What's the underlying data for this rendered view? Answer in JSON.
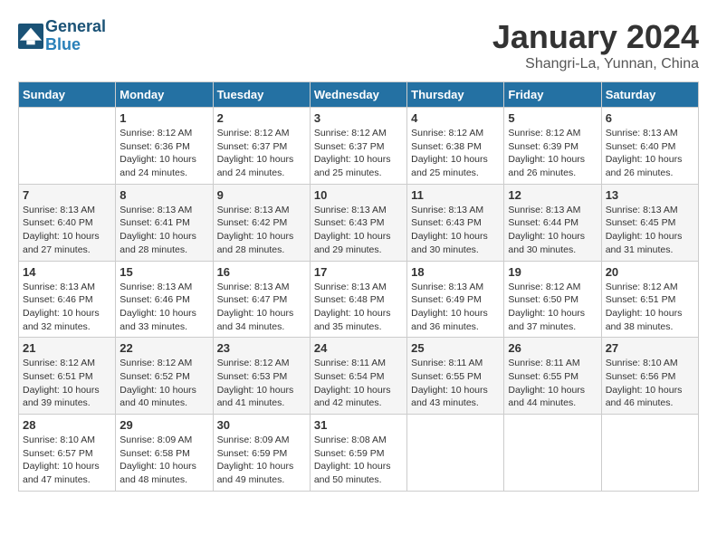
{
  "header": {
    "logo_line1": "General",
    "logo_line2": "Blue",
    "month": "January 2024",
    "location": "Shangri-La, Yunnan, China"
  },
  "weekdays": [
    "Sunday",
    "Monday",
    "Tuesday",
    "Wednesday",
    "Thursday",
    "Friday",
    "Saturday"
  ],
  "weeks": [
    [
      {
        "day": "",
        "sunrise": "",
        "sunset": "",
        "daylight": ""
      },
      {
        "day": "1",
        "sunrise": "Sunrise: 8:12 AM",
        "sunset": "Sunset: 6:36 PM",
        "daylight": "Daylight: 10 hours and 24 minutes."
      },
      {
        "day": "2",
        "sunrise": "Sunrise: 8:12 AM",
        "sunset": "Sunset: 6:37 PM",
        "daylight": "Daylight: 10 hours and 24 minutes."
      },
      {
        "day": "3",
        "sunrise": "Sunrise: 8:12 AM",
        "sunset": "Sunset: 6:37 PM",
        "daylight": "Daylight: 10 hours and 25 minutes."
      },
      {
        "day": "4",
        "sunrise": "Sunrise: 8:12 AM",
        "sunset": "Sunset: 6:38 PM",
        "daylight": "Daylight: 10 hours and 25 minutes."
      },
      {
        "day": "5",
        "sunrise": "Sunrise: 8:12 AM",
        "sunset": "Sunset: 6:39 PM",
        "daylight": "Daylight: 10 hours and 26 minutes."
      },
      {
        "day": "6",
        "sunrise": "Sunrise: 8:13 AM",
        "sunset": "Sunset: 6:40 PM",
        "daylight": "Daylight: 10 hours and 26 minutes."
      }
    ],
    [
      {
        "day": "7",
        "sunrise": "Sunrise: 8:13 AM",
        "sunset": "Sunset: 6:40 PM",
        "daylight": "Daylight: 10 hours and 27 minutes."
      },
      {
        "day": "8",
        "sunrise": "Sunrise: 8:13 AM",
        "sunset": "Sunset: 6:41 PM",
        "daylight": "Daylight: 10 hours and 28 minutes."
      },
      {
        "day": "9",
        "sunrise": "Sunrise: 8:13 AM",
        "sunset": "Sunset: 6:42 PM",
        "daylight": "Daylight: 10 hours and 28 minutes."
      },
      {
        "day": "10",
        "sunrise": "Sunrise: 8:13 AM",
        "sunset": "Sunset: 6:43 PM",
        "daylight": "Daylight: 10 hours and 29 minutes."
      },
      {
        "day": "11",
        "sunrise": "Sunrise: 8:13 AM",
        "sunset": "Sunset: 6:43 PM",
        "daylight": "Daylight: 10 hours and 30 minutes."
      },
      {
        "day": "12",
        "sunrise": "Sunrise: 8:13 AM",
        "sunset": "Sunset: 6:44 PM",
        "daylight": "Daylight: 10 hours and 30 minutes."
      },
      {
        "day": "13",
        "sunrise": "Sunrise: 8:13 AM",
        "sunset": "Sunset: 6:45 PM",
        "daylight": "Daylight: 10 hours and 31 minutes."
      }
    ],
    [
      {
        "day": "14",
        "sunrise": "Sunrise: 8:13 AM",
        "sunset": "Sunset: 6:46 PM",
        "daylight": "Daylight: 10 hours and 32 minutes."
      },
      {
        "day": "15",
        "sunrise": "Sunrise: 8:13 AM",
        "sunset": "Sunset: 6:46 PM",
        "daylight": "Daylight: 10 hours and 33 minutes."
      },
      {
        "day": "16",
        "sunrise": "Sunrise: 8:13 AM",
        "sunset": "Sunset: 6:47 PM",
        "daylight": "Daylight: 10 hours and 34 minutes."
      },
      {
        "day": "17",
        "sunrise": "Sunrise: 8:13 AM",
        "sunset": "Sunset: 6:48 PM",
        "daylight": "Daylight: 10 hours and 35 minutes."
      },
      {
        "day": "18",
        "sunrise": "Sunrise: 8:13 AM",
        "sunset": "Sunset: 6:49 PM",
        "daylight": "Daylight: 10 hours and 36 minutes."
      },
      {
        "day": "19",
        "sunrise": "Sunrise: 8:12 AM",
        "sunset": "Sunset: 6:50 PM",
        "daylight": "Daylight: 10 hours and 37 minutes."
      },
      {
        "day": "20",
        "sunrise": "Sunrise: 8:12 AM",
        "sunset": "Sunset: 6:51 PM",
        "daylight": "Daylight: 10 hours and 38 minutes."
      }
    ],
    [
      {
        "day": "21",
        "sunrise": "Sunrise: 8:12 AM",
        "sunset": "Sunset: 6:51 PM",
        "daylight": "Daylight: 10 hours and 39 minutes."
      },
      {
        "day": "22",
        "sunrise": "Sunrise: 8:12 AM",
        "sunset": "Sunset: 6:52 PM",
        "daylight": "Daylight: 10 hours and 40 minutes."
      },
      {
        "day": "23",
        "sunrise": "Sunrise: 8:12 AM",
        "sunset": "Sunset: 6:53 PM",
        "daylight": "Daylight: 10 hours and 41 minutes."
      },
      {
        "day": "24",
        "sunrise": "Sunrise: 8:11 AM",
        "sunset": "Sunset: 6:54 PM",
        "daylight": "Daylight: 10 hours and 42 minutes."
      },
      {
        "day": "25",
        "sunrise": "Sunrise: 8:11 AM",
        "sunset": "Sunset: 6:55 PM",
        "daylight": "Daylight: 10 hours and 43 minutes."
      },
      {
        "day": "26",
        "sunrise": "Sunrise: 8:11 AM",
        "sunset": "Sunset: 6:55 PM",
        "daylight": "Daylight: 10 hours and 44 minutes."
      },
      {
        "day": "27",
        "sunrise": "Sunrise: 8:10 AM",
        "sunset": "Sunset: 6:56 PM",
        "daylight": "Daylight: 10 hours and 46 minutes."
      }
    ],
    [
      {
        "day": "28",
        "sunrise": "Sunrise: 8:10 AM",
        "sunset": "Sunset: 6:57 PM",
        "daylight": "Daylight: 10 hours and 47 minutes."
      },
      {
        "day": "29",
        "sunrise": "Sunrise: 8:09 AM",
        "sunset": "Sunset: 6:58 PM",
        "daylight": "Daylight: 10 hours and 48 minutes."
      },
      {
        "day": "30",
        "sunrise": "Sunrise: 8:09 AM",
        "sunset": "Sunset: 6:59 PM",
        "daylight": "Daylight: 10 hours and 49 minutes."
      },
      {
        "day": "31",
        "sunrise": "Sunrise: 8:08 AM",
        "sunset": "Sunset: 6:59 PM",
        "daylight": "Daylight: 10 hours and 50 minutes."
      },
      {
        "day": "",
        "sunrise": "",
        "sunset": "",
        "daylight": ""
      },
      {
        "day": "",
        "sunrise": "",
        "sunset": "",
        "daylight": ""
      },
      {
        "day": "",
        "sunrise": "",
        "sunset": "",
        "daylight": ""
      }
    ]
  ]
}
